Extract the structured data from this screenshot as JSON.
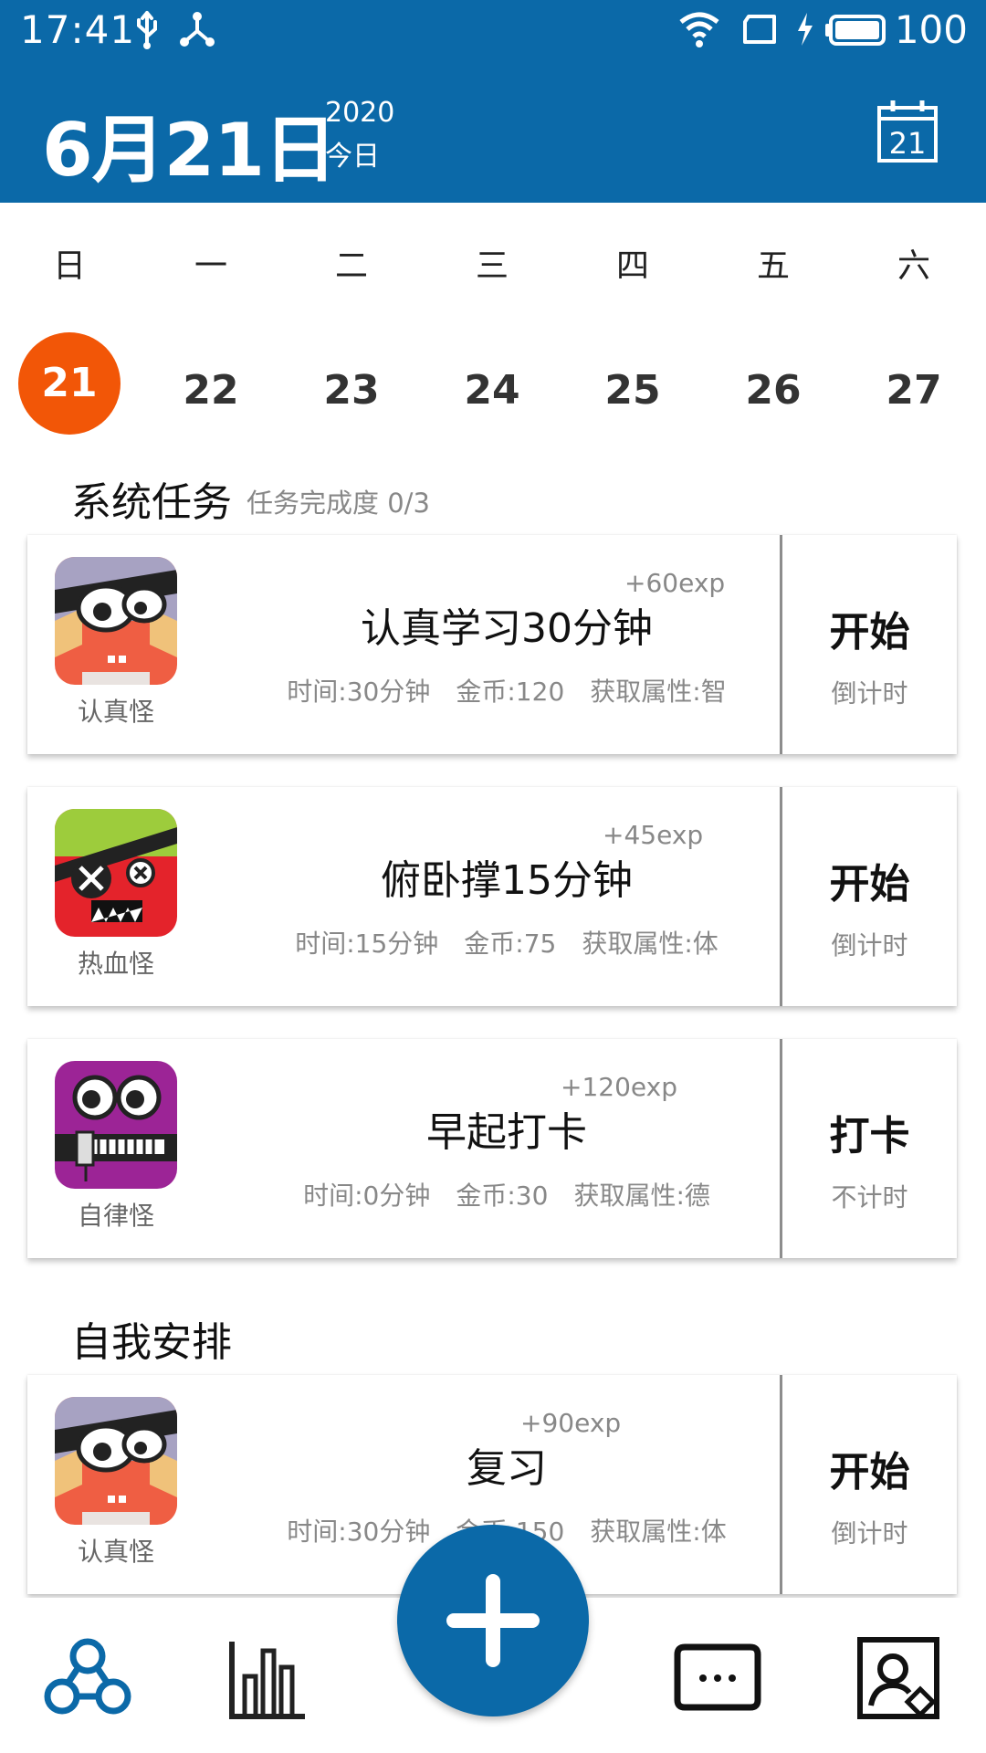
{
  "status_bar": {
    "time": "17:41",
    "battery": "100",
    "icons": [
      "usb-icon",
      "share-icon",
      "wifi-icon",
      "sim-icon",
      "charging-icon",
      "battery-icon"
    ]
  },
  "header": {
    "date": "6月21日",
    "year": "2020",
    "today_label": "今日",
    "calendar_day": "21",
    "color": "#0b69a8"
  },
  "week": {
    "weekdays": [
      "日",
      "一",
      "二",
      "三",
      "四",
      "五",
      "六"
    ],
    "days": [
      "21",
      "22",
      "23",
      "24",
      "25",
      "26",
      "27"
    ],
    "selected_index": 0,
    "selected_color": "#f25607"
  },
  "system_section": {
    "title": "系统任务",
    "progress_label": "任务完成度 0/3"
  },
  "system_tasks": [
    {
      "title": "认真学习30分钟",
      "exp": "+60exp",
      "time": "时间:30分钟",
      "coins": "金币:120",
      "attribute": "获取属性:智",
      "avatar_name": "认真怪",
      "avatar_icon": "serious-monster-icon",
      "action": "开始",
      "action_sub": "倒计时"
    },
    {
      "title": "俯卧撑15分钟",
      "exp": "+45exp",
      "time": "时间:15分钟",
      "coins": "金币:75",
      "attribute": "获取属性:体",
      "avatar_name": "热血怪",
      "avatar_icon": "hot-blooded-monster-icon",
      "action": "开始",
      "action_sub": "倒计时"
    },
    {
      "title": "早起打卡",
      "exp": "+120exp",
      "time": "时间:0分钟",
      "coins": "金币:30",
      "attribute": "获取属性:德",
      "avatar_name": "自律怪",
      "avatar_icon": "self-discipline-monster-icon",
      "action": "打卡",
      "action_sub": "不计时"
    }
  ],
  "self_section": {
    "title": "自我安排"
  },
  "self_tasks": [
    {
      "title": "复习",
      "exp": "+90exp",
      "time": "时间:30分钟",
      "coins": "金币:150",
      "attribute": "获取属性:体",
      "avatar_name": "认真怪",
      "avatar_icon": "serious-monster-icon",
      "action": "开始",
      "action_sub": "倒计时"
    }
  ],
  "bottom_nav": {
    "items": [
      "home-network-icon",
      "stats-chart-icon",
      "add-icon",
      "message-icon",
      "profile-card-icon"
    ]
  }
}
